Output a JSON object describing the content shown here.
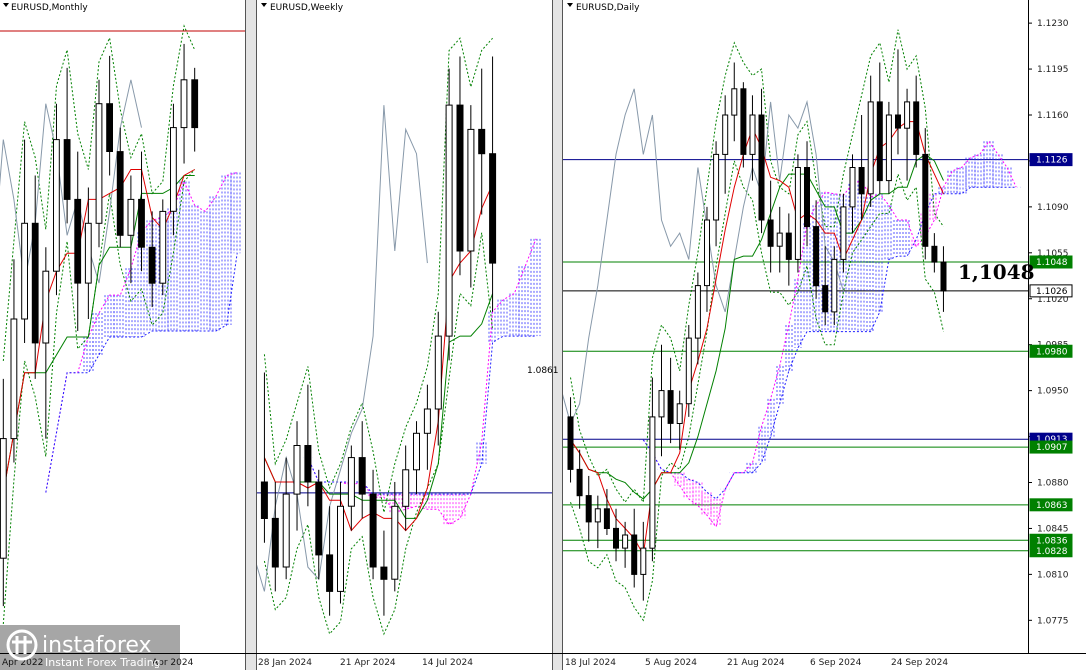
{
  "panels": [
    {
      "symbol": "EURUSD,Monthly",
      "dates": [
        "Apr 2022",
        "Apr 2024"
      ]
    },
    {
      "symbol": "EURUSD,Weekly",
      "dates": [
        "28 Jan 2024",
        "21 Apr 2024",
        "14 Jul 2024"
      ]
    },
    {
      "symbol": "EURUSD,Daily",
      "dates": [
        "18 Jul 2024",
        "5 Aug 2024",
        "21 Aug 2024",
        "6 Sep 2024",
        "24 Sep 2024"
      ]
    }
  ],
  "weekly_level_label": "1.0861",
  "annotation": "1,1048",
  "watermark": {
    "brand": "instaforex",
    "tagline": "Instant Forex Trading"
  },
  "colors": {
    "bull": "#ffffff",
    "bear": "#000000",
    "tenkan": "#e00000",
    "kijun": "#008000",
    "level_green": "#008000",
    "level_blue": "#00008b",
    "cloud_pink": "#ff00ff",
    "cloud_blue": "#2020ff",
    "axis_tag_dark": "#00008b"
  },
  "chart_data": [
    {
      "type": "candlestick",
      "title": "EURUSD,Monthly",
      "x_ticks": [
        "Apr 2022",
        "Apr 2024"
      ],
      "ylim": [
        1.074,
        1.125
      ],
      "visible_window_note": "price scale shared visually with daily panel",
      "series": [
        {
          "name": "candles",
          "ohlc": [
            [
              1.08,
              1.095,
              1.076,
              1.09
            ],
            [
              1.09,
              1.105,
              1.088,
              1.1
            ],
            [
              1.1,
              1.115,
              1.098,
              1.108
            ],
            [
              1.108,
              1.112,
              1.095,
              1.098
            ],
            [
              1.098,
              1.106,
              1.09,
              1.104
            ],
            [
              1.104,
              1.118,
              1.102,
              1.115
            ],
            [
              1.115,
              1.121,
              1.108,
              1.11
            ],
            [
              1.11,
              1.114,
              1.099,
              1.103
            ],
            [
              1.103,
              1.111,
              1.1,
              1.108
            ],
            [
              1.108,
              1.12,
              1.106,
              1.118
            ],
            [
              1.118,
              1.122,
              1.112,
              1.114
            ],
            [
              1.114,
              1.116,
              1.106,
              1.107
            ],
            [
              1.107,
              1.112,
              1.103,
              1.11
            ],
            [
              1.11,
              1.114,
              1.104,
              1.106
            ],
            [
              1.106,
              1.109,
              1.101,
              1.103
            ],
            [
              1.103,
              1.11,
              1.102,
              1.109
            ],
            [
              1.109,
              1.118,
              1.107,
              1.116
            ],
            [
              1.116,
              1.123,
              1.113,
              1.12
            ],
            [
              1.12,
              1.121,
              1.114,
              1.116
            ]
          ]
        }
      ]
    },
    {
      "type": "candlestick",
      "title": "EURUSD,Weekly",
      "x_ticks": [
        "28 Jan 2024",
        "21 Apr 2024",
        "14 Jul 2024"
      ],
      "ylim": [
        1.074,
        1.125
      ],
      "level": 1.0861,
      "series": [
        {
          "name": "candles",
          "ohlc": [
            [
              1.087,
              1.096,
              1.082,
              1.084
            ],
            [
              1.084,
              1.087,
              1.078,
              1.08
            ],
            [
              1.08,
              1.089,
              1.079,
              1.086
            ],
            [
              1.086,
              1.092,
              1.083,
              1.09
            ],
            [
              1.09,
              1.095,
              1.085,
              1.087
            ],
            [
              1.087,
              1.088,
              1.079,
              1.081
            ],
            [
              1.081,
              1.085,
              1.076,
              1.078
            ],
            [
              1.078,
              1.087,
              1.077,
              1.085
            ],
            [
              1.085,
              1.09,
              1.083,
              1.089
            ],
            [
              1.089,
              1.092,
              1.084,
              1.086
            ],
            [
              1.086,
              1.088,
              1.079,
              1.08
            ],
            [
              1.08,
              1.083,
              1.076,
              1.079
            ],
            [
              1.079,
              1.087,
              1.078,
              1.085
            ],
            [
              1.085,
              1.09,
              1.083,
              1.088
            ],
            [
              1.088,
              1.092,
              1.086,
              1.091
            ],
            [
              1.091,
              1.095,
              1.088,
              1.093
            ],
            [
              1.093,
              1.101,
              1.09,
              1.099
            ],
            [
              1.099,
              1.121,
              1.097,
              1.118
            ],
            [
              1.118,
              1.122,
              1.104,
              1.106
            ],
            [
              1.106,
              1.118,
              1.103,
              1.116
            ],
            [
              1.116,
              1.121,
              1.109,
              1.114
            ],
            [
              1.114,
              1.122,
              1.101,
              1.105
            ]
          ]
        }
      ]
    },
    {
      "type": "candlestick",
      "title": "EURUSD,Daily",
      "x_ticks": [
        "18 Jul 2024",
        "5 Aug 2024",
        "21 Aug 2024",
        "6 Sep 2024",
        "24 Sep 2024"
      ],
      "ylim": [
        1.076,
        1.124
      ],
      "y_ticks": [
        1.123,
        1.1195,
        1.116,
        1.1125,
        1.109,
        1.1055,
        1.102,
        1.0985,
        1.095,
        1.0915,
        1.088,
        1.0845,
        1.081,
        1.0775
      ],
      "levels": [
        {
          "value": 1.1126,
          "color": "#00008b"
        },
        {
          "value": 1.1048,
          "color": "#008000"
        },
        {
          "value": 1.1026,
          "color": "#000000"
        },
        {
          "value": 1.098,
          "color": "#008000"
        },
        {
          "value": 1.0913,
          "color": "#00008b"
        },
        {
          "value": 1.0907,
          "color": "#008000"
        },
        {
          "value": 1.0863,
          "color": "#008000"
        },
        {
          "value": 1.0836,
          "color": "#008000"
        },
        {
          "value": 1.0828,
          "color": "#008000"
        }
      ],
      "series": [
        {
          "name": "candles",
          "ohlc": [
            [
              1.093,
              1.0945,
              1.088,
              1.089
            ],
            [
              1.089,
              1.0905,
              1.086,
              1.087
            ],
            [
              1.087,
              1.0885,
              1.0835,
              1.085
            ],
            [
              1.085,
              1.087,
              1.083,
              1.086
            ],
            [
              1.086,
              1.0875,
              1.084,
              1.0845
            ],
            [
              1.0845,
              1.086,
              1.082,
              1.083
            ],
            [
              1.083,
              1.085,
              1.0815,
              1.084
            ],
            [
              1.084,
              1.086,
              1.08,
              1.081
            ],
            [
              1.081,
              1.085,
              1.079,
              1.083
            ],
            [
              1.083,
              1.096,
              1.082,
              1.093
            ],
            [
              1.093,
              1.0985,
              1.09,
              1.095
            ],
            [
              1.095,
              1.0975,
              1.091,
              1.0925
            ],
            [
              1.0925,
              1.095,
              1.0905,
              1.094
            ],
            [
              1.094,
              1.1,
              1.093,
              1.099
            ],
            [
              1.099,
              1.104,
              1.097,
              1.103
            ],
            [
              1.103,
              1.109,
              1.101,
              1.108
            ],
            [
              1.108,
              1.114,
              1.106,
              1.113
            ],
            [
              1.113,
              1.1175,
              1.11,
              1.116
            ],
            [
              1.116,
              1.12,
              1.114,
              1.118
            ],
            [
              1.118,
              1.1185,
              1.112,
              1.113
            ],
            [
              1.113,
              1.1175,
              1.111,
              1.116
            ],
            [
              1.116,
              1.118,
              1.107,
              1.108
            ],
            [
              1.108,
              1.111,
              1.104,
              1.106
            ],
            [
              1.106,
              1.109,
              1.104,
              1.107
            ],
            [
              1.107,
              1.1085,
              1.103,
              1.105
            ],
            [
              1.105,
              1.113,
              1.104,
              1.112
            ],
            [
              1.112,
              1.114,
              1.106,
              1.1075
            ],
            [
              1.1075,
              1.1095,
              1.102,
              1.103
            ],
            [
              1.103,
              1.106,
              1.1,
              1.101
            ],
            [
              1.101,
              1.106,
              1.1,
              1.105
            ],
            [
              1.105,
              1.11,
              1.104,
              1.109
            ],
            [
              1.109,
              1.113,
              1.107,
              1.112
            ],
            [
              1.112,
              1.116,
              1.108,
              1.11
            ],
            [
              1.11,
              1.119,
              1.109,
              1.117
            ],
            [
              1.117,
              1.12,
              1.11,
              1.111
            ],
            [
              1.111,
              1.117,
              1.11,
              1.116
            ],
            [
              1.116,
              1.121,
              1.113,
              1.115
            ],
            [
              1.115,
              1.118,
              1.111,
              1.117
            ],
            [
              1.117,
              1.119,
              1.112,
              1.113
            ],
            [
              1.113,
              1.115,
              1.105,
              1.106
            ],
            [
              1.106,
              1.107,
              1.104,
              1.1048
            ],
            [
              1.1048,
              1.106,
              1.101,
              1.1026
            ]
          ]
        }
      ]
    }
  ]
}
